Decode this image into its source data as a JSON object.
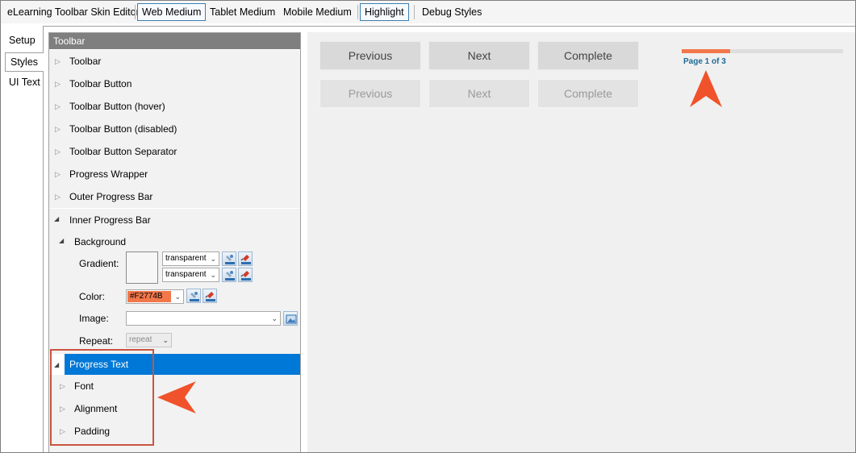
{
  "toolbar": {
    "app_title": "eLearning Toolbar Skin Editor",
    "web_medium": "Web Medium",
    "tablet_medium": "Tablet Medium",
    "mobile_medium": "Mobile Medium",
    "highlight": "Highlight",
    "debug_styles": "Debug Styles"
  },
  "tabs": {
    "setup": "Setup",
    "styles": "Styles",
    "ui_text": "UI Text"
  },
  "tree": {
    "header": "Toolbar",
    "items": [
      "Toolbar",
      "Toolbar Button",
      "Toolbar Button (hover)",
      "Toolbar Button (disabled)",
      "Toolbar Button Separator",
      "Progress Wrapper",
      "Outer Progress Bar"
    ],
    "inner_progress_bar": "Inner Progress Bar",
    "background": "Background",
    "gradient_label": "Gradient:",
    "gradient_from": "transparent",
    "gradient_to": "transparent",
    "color_label": "Color:",
    "color_value": "#F2774B",
    "image_label": "Image:",
    "image_value": "",
    "repeat_label": "Repeat:",
    "repeat_value": "repeat",
    "progress_text": "Progress Text",
    "children": [
      "Font",
      "Alignment",
      "Padding"
    ]
  },
  "preview": {
    "row1": {
      "previous": "Previous",
      "next": "Next",
      "complete": "Complete"
    },
    "row2": {
      "previous": "Previous",
      "next": "Next",
      "complete": "Complete"
    },
    "progress_fraction": 0.3,
    "progress_text": "Page 1 of 3"
  },
  "colors": {
    "accent": "#F2774B",
    "selection": "#0078D7",
    "progress_text": "#1E6A96",
    "callout_arrow": "#F0522B"
  }
}
